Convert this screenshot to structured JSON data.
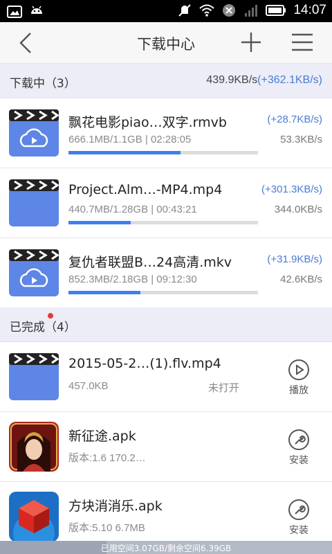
{
  "status_bar": {
    "time": "14:07"
  },
  "header": {
    "title": "下载中心"
  },
  "downloading": {
    "title": "下载中（3）",
    "speed": "439.9KB/s",
    "extra_speed": "(+362.1KB/s)",
    "items": [
      {
        "name": "飘花电影piao…双字.rmvb",
        "meta": "666.1MB/1.1GB | 02:28:05",
        "extra_speed": "(+28.7KB/s)",
        "speed": "53.3KB/s",
        "progress": 0.59
      },
      {
        "name": "Project.Alm…-MP4.mp4",
        "meta": "440.7MB/1.28GB | 00:43:21",
        "extra_speed": "(+301.3KB/s)",
        "speed": "344.0KB/s",
        "progress": 0.33
      },
      {
        "name": "复仇者联盟B…24高清.mkv",
        "meta": "852.3MB/2.18GB | 09:12:30",
        "extra_speed": "(+31.9KB/s)",
        "speed": "42.6KB/s",
        "progress": 0.38
      }
    ]
  },
  "completed": {
    "title": "已完成（4）",
    "items": [
      {
        "name": "2015-05-2…(1).flv.mp4",
        "meta": "457.0KB",
        "status": "未打开",
        "action": "播放",
        "icon": "play-circle-icon"
      },
      {
        "name": "新征途.apk",
        "meta": "版本:1.6    170.2…",
        "status": "",
        "action": "安装",
        "icon": "wrench-icon"
      },
      {
        "name": "方块消消乐.apk",
        "meta": "版本:5.10    6.7MB",
        "status": "",
        "action": "安装",
        "icon": "wrench-icon"
      }
    ]
  },
  "storage": {
    "text": "已用空间3.07GB/剩余空间6.39GB",
    "used_fraction": 0.32
  },
  "colors": {
    "accent": "#3d7ff0",
    "extra_speed": "#4a7bd6",
    "video_thumb": "#5d86e6",
    "section_bg": "#ecedf6"
  }
}
